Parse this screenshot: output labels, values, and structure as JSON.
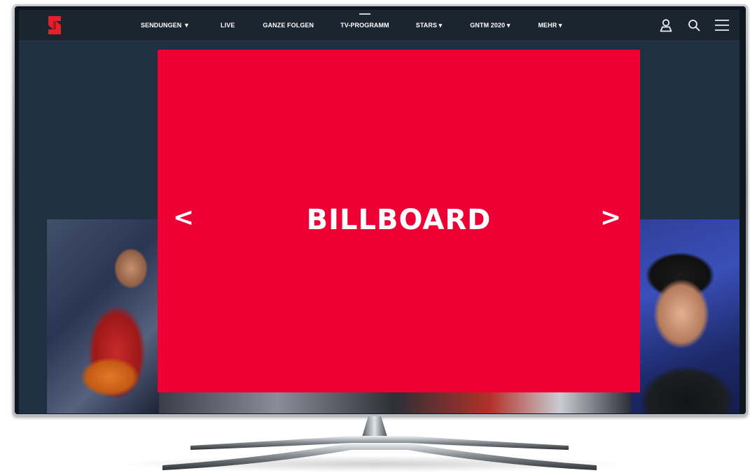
{
  "nav": {
    "items": [
      {
        "label": "SENDUNGEN ▼"
      },
      {
        "label": "LIVE"
      },
      {
        "label": "GANZE FOLGEN"
      },
      {
        "label": "TV-PROGRAMM"
      },
      {
        "label": "STARS ▾"
      },
      {
        "label": "GNTM 2020 ▾"
      },
      {
        "label": "MEHR ▾"
      }
    ],
    "icons": [
      "user-icon",
      "search-icon",
      "menu-icon"
    ]
  },
  "billboard": {
    "title": "BILLBOARD",
    "prev": "<",
    "next": ">"
  },
  "colors": {
    "billboard": "#ee0035",
    "navbar": "#1b2530",
    "page_background": "#1f3042",
    "logo_red": "#e6202a"
  }
}
